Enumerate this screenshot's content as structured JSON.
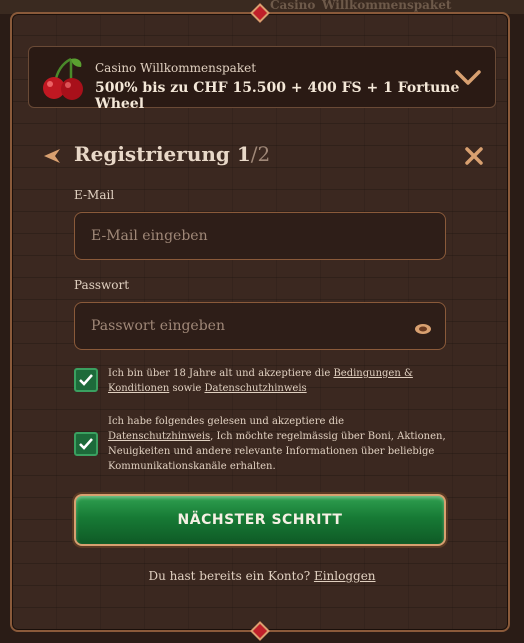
{
  "background": {
    "strip_text_1": "Casino",
    "strip_text_2": "Willkommenspaket"
  },
  "promo": {
    "label": "Casino Willkommenspaket",
    "offer": "500% bis zu CHF 15.500 + 400 FS + 1 Fortune Wheel",
    "icon": "cherry-icon",
    "expand_icon": "chevron-down-icon"
  },
  "header": {
    "title": "Registrierung",
    "step_current": "1",
    "step_total": "/2",
    "back_icon": "back-arrow-icon",
    "close_icon": "close-icon"
  },
  "form": {
    "email_label": "E-Mail",
    "email_placeholder": "E-Mail eingeben",
    "email_value": "",
    "password_label": "Passwort",
    "password_placeholder": "Passwort eingeben",
    "password_value": "",
    "password_toggle_icon": "eye-icon"
  },
  "consents": [
    {
      "checked": true,
      "text_before": "Ich bin über 18 Jahre alt und akzeptiere die ",
      "link1": "Bedingungen & Konditionen",
      "text_middle": " sowie ",
      "link2": "Datenschutzhinweis"
    },
    {
      "checked": true,
      "text_before": "Ich habe folgendes gelesen und akzeptiere die ",
      "link1": "Datenschutzhinweis",
      "text_after": ", Ich möchte regelmässig über Boni, Aktionen, Neuigkeiten und andere relevante Informationen über beliebige Kommunikationskanäle erhalten."
    }
  ],
  "cta": {
    "label": "NÄCHSTER SCHRITT"
  },
  "footer": {
    "question": "Du hast bereits ein Konto? ",
    "login_link": "Einloggen"
  },
  "colors": {
    "accent_gold": "#d8a070",
    "cta_green": "#177a35",
    "panel_brown": "#3b2820",
    "gem_red": "#c0202a"
  }
}
